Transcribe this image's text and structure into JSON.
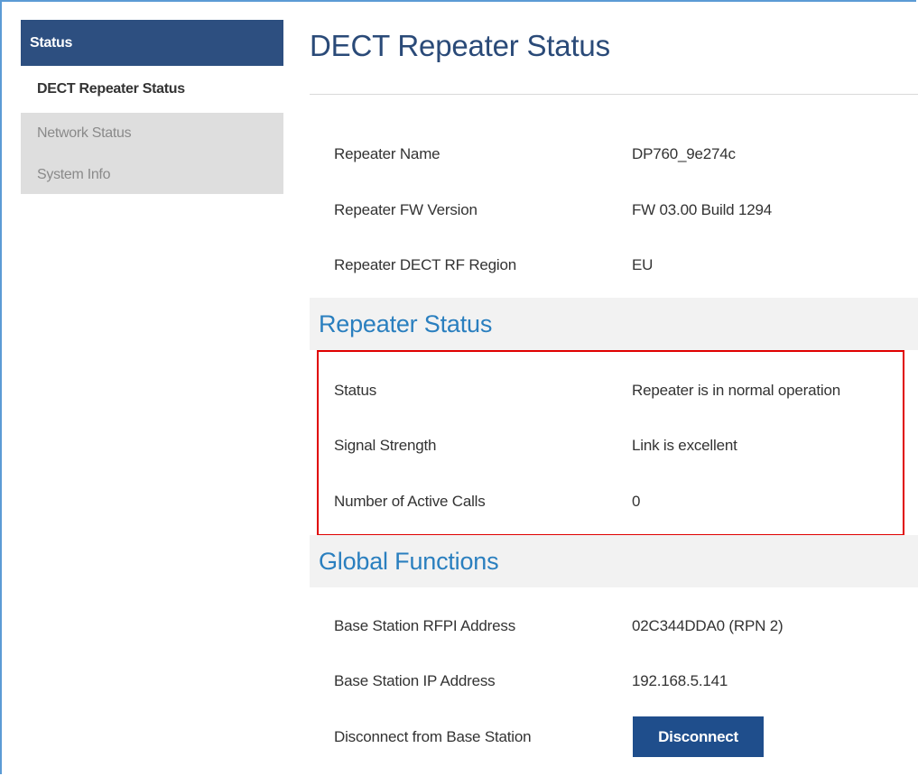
{
  "sidebar": {
    "header": "Status",
    "active_item": "DECT Repeater Status",
    "items": [
      {
        "label": "Network Status"
      },
      {
        "label": "System Info"
      }
    ]
  },
  "main": {
    "title": "DECT Repeater Status",
    "info_rows": [
      {
        "label": "Repeater Name",
        "value": "DP760_9e274c"
      },
      {
        "label": "Repeater FW Version",
        "value": "FW 03.00 Build 1294"
      },
      {
        "label": "Repeater DECT RF Region",
        "value": "EU"
      }
    ],
    "repeater_status": {
      "heading": "Repeater Status",
      "rows": [
        {
          "label": "Status",
          "value": "Repeater is in normal operation"
        },
        {
          "label": "Signal Strength",
          "value": "Link is excellent"
        },
        {
          "label": "Number of Active Calls",
          "value": "0"
        }
      ]
    },
    "global_functions": {
      "heading": "Global Functions",
      "rows": [
        {
          "label": "Base Station RFPI Address",
          "value": "02C344DDA0 (RPN 2)"
        },
        {
          "label": "Base Station IP Address",
          "value": "192.168.5.141"
        },
        {
          "label": "Disconnect from Base Station"
        }
      ],
      "disconnect_label": "Disconnect"
    }
  },
  "colors": {
    "sidebar_header_bg": "#2d4f80",
    "title_color": "#2a4a78",
    "section_heading_color": "#2a7fbf",
    "highlight_border": "#e00000",
    "button_bg": "#1f4e8c"
  }
}
